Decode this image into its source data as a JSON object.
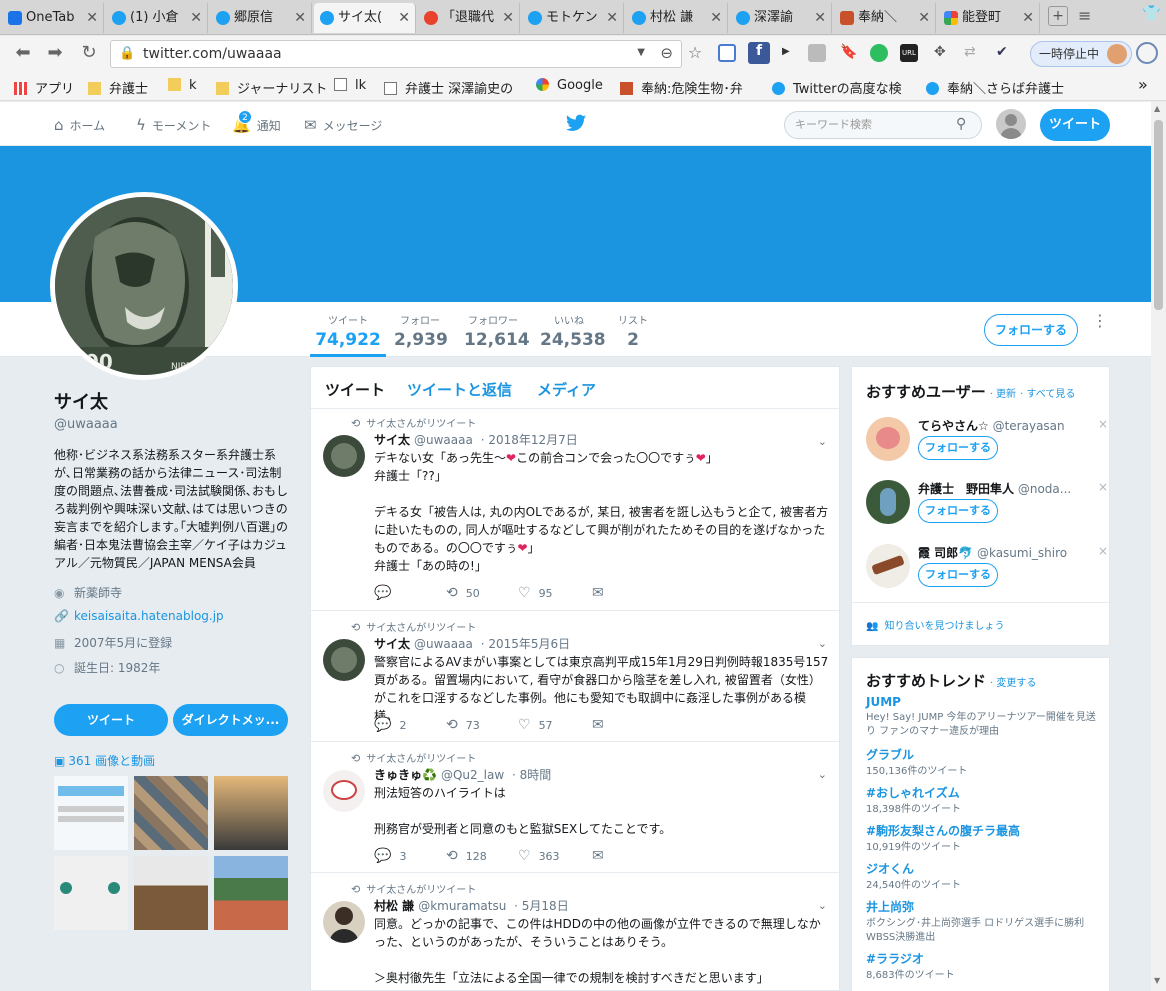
{
  "browser": {
    "tabs": [
      {
        "label": "OneTab",
        "favicon": "onetab-icon",
        "active": false
      },
      {
        "label": "(1) 小倉",
        "favicon": "twitter-bird-icon",
        "active": false
      },
      {
        "label": "郷原信",
        "favicon": "twitter-bird-icon",
        "active": false
      },
      {
        "label": "サイ太(",
        "favicon": "twitter-bird-icon",
        "active": true
      },
      {
        "label": "「退職代",
        "favicon": "hatena-icon",
        "active": false
      },
      {
        "label": "モトケン",
        "favicon": "twitter-bird-icon",
        "active": false
      },
      {
        "label": "村松 謙",
        "favicon": "twitter-bird-icon",
        "active": false
      },
      {
        "label": "深澤諭",
        "favicon": "twitter-bird-icon",
        "active": false
      },
      {
        "label": "奉納＼",
        "favicon": "blog-icon",
        "active": false
      },
      {
        "label": "能登町",
        "favicon": "google-icon",
        "active": false
      }
    ],
    "url": "twitter.com/uwaaaa",
    "pause_label": "一時停止中",
    "bookmarks": [
      {
        "label": "アプリ",
        "icon": "apps-grid-icon"
      },
      {
        "label": "弁護士",
        "icon": "folder-icon"
      },
      {
        "label": "k",
        "icon": "folder-icon"
      },
      {
        "label": "ジャーナリスト",
        "icon": "folder-icon"
      },
      {
        "label": "lk",
        "icon": "page-icon"
      },
      {
        "label": "弁護士 深澤諭史の",
        "icon": "page-icon"
      },
      {
        "label": "Google",
        "icon": "google-icon"
      },
      {
        "label": "奉納:危険生物･弁",
        "icon": "blog-icon"
      },
      {
        "label": "Twitterの高度な検",
        "icon": "twitter-bird-icon"
      },
      {
        "label": "奉納＼さらば弁護士",
        "icon": "twitter-bird-icon"
      }
    ]
  },
  "twitter_nav": {
    "home": "ホーム",
    "moments": "モーメント",
    "notifications": "通知",
    "notifications_badge": "2",
    "messages": "メッセージ",
    "search_placeholder": "キーワード検索",
    "tweet_button": "ツイート"
  },
  "profile_stats": [
    {
      "label": "ツイート",
      "value": "74,922",
      "active": true
    },
    {
      "label": "フォロー",
      "value": "2,939",
      "active": false
    },
    {
      "label": "フォロワー",
      "value": "12,614",
      "active": false
    },
    {
      "label": "いいね",
      "value": "24,538",
      "active": false
    },
    {
      "label": "リスト",
      "value": "2",
      "active": false
    }
  ],
  "follow_button": "フォローする",
  "profile": {
    "name": "サイ太",
    "handle": "@uwaaaa",
    "bio": "他称･ビジネス系法務系スター系弁護士系が､日常業務の話から法律ニュース･司法制度の問題点､法曹養成･司法試験関係､おもしろ裁判例や興味深い文献､はては思いつきの妄言までを紹介します｡｢大嘘判例八百選｣の編者･日本鬼法曹協会主宰／ケイ子はカジュアル／元物質民／JAPAN MENSA会員",
    "location": "新薬師寺",
    "website": "keisaisaita.hatenablog.jp",
    "joined": "2007年5月に登録",
    "birthday": "誕生日: 1982年",
    "tweet_button": "ツイート",
    "dm_button": "ダイレクトメッ...",
    "media_link": "361 画像と動画"
  },
  "timeline": {
    "tabs": [
      "ツイート",
      "ツイートと返信",
      "メディア"
    ],
    "tweets": [
      {
        "retweet_label": "サイ太さんがリツイート",
        "name": "サイ太",
        "handle": "@uwaaaa",
        "date": "· 2018年12月7日",
        "text": "デキない女「あっ先生〜❤この前合コンで会った〇〇ですぅ❤」\n弁護士「??」\n\nデキる女「被告人は, 丸の内OLであるが, 某日, 被害者を誑し込もうと企て, 被害者方に赴いたものの, 同人が嘔吐するなどして興が削がれたためその目的を遂げなかったものである。の〇〇ですぅ❤」\n弁護士「あの時の!」",
        "replies": "",
        "retweets": "50",
        "likes": "95"
      },
      {
        "retweet_label": "サイ太さんがリツイート",
        "name": "サイ太",
        "handle": "@uwaaaa",
        "date": "· 2015年5月6日",
        "text": "警察官によるAVまがい事案としては東京高判平成15年1月29日判例時報1835号157頁がある。留置場内において, 看守が食器口から陰茎を差し入れ, 被留置者（女性）がこれを口淫するなどした事例。他にも愛知でも取調中に姦淫した事例がある模様。",
        "replies": "2",
        "retweets": "73",
        "likes": "57"
      },
      {
        "retweet_label": "サイ太さんがリツイート",
        "name": "きゅきゅ♻️",
        "handle": "@Qu2_law",
        "date": "· 8時間",
        "text": "刑法短答のハイライトは\n\n刑務官が受刑者と同意のもと監獄SEXしてたことです。",
        "replies": "3",
        "retweets": "128",
        "likes": "363"
      },
      {
        "retweet_label": "サイ太さんがリツイート",
        "name": "村松 謙",
        "handle": "@kmuramatsu",
        "date": "· 5月18日",
        "text": "同意。どっかの記事で、この件はHDDの中の他の画像が立件できるので無理しなかった、というのがあったが、そういうことはありそう。\n\n＞奥村徹先生「立法による全国一律での規制を検討すべきだと思います」",
        "replies": "",
        "retweets": "",
        "likes": ""
      }
    ]
  },
  "suggestions": {
    "title": "おすすめユーザー",
    "refresh": "· 更新",
    "view_all": "· すべて見る",
    "follow_label": "フォローする",
    "users": [
      {
        "name": "てらやさん☆",
        "handle": "@terayasan"
      },
      {
        "name": "弁護士　野田隼人",
        "handle": "@noda..."
      },
      {
        "name": "霞 司郎🐬",
        "handle": "@kasumi_shiro"
      }
    ],
    "find_friends": "知り合いを見つけましょう"
  },
  "trends": {
    "title": "おすすめトレンド",
    "change": "· 変更する",
    "items": [
      {
        "name": "JUMP",
        "desc": "Hey! Say! JUMP 今年のアリーナツアー開催を見送り ファンのマナー違反が理由"
      },
      {
        "name": "グラブル",
        "desc": "150,136件のツイート"
      },
      {
        "name": "#おしゃれイズム",
        "desc": "18,398件のツイート"
      },
      {
        "name": "#駒形友梨さんの腹チラ最高",
        "desc": "10,919件のツイート"
      },
      {
        "name": "ジオくん",
        "desc": "24,540件のツイート"
      },
      {
        "name": "井上尚弥",
        "desc": "ボクシング･井上尚弥選手 ロドリゲス選手に勝利 WBSS決勝進出"
      },
      {
        "name": "#ララジオ",
        "desc": "8,683件のツイート"
      }
    ]
  },
  "colors": {
    "accent": "#1da1f2",
    "banner": "#1b95e0",
    "background": "#e6ecf0",
    "heart": "#e0245e"
  }
}
